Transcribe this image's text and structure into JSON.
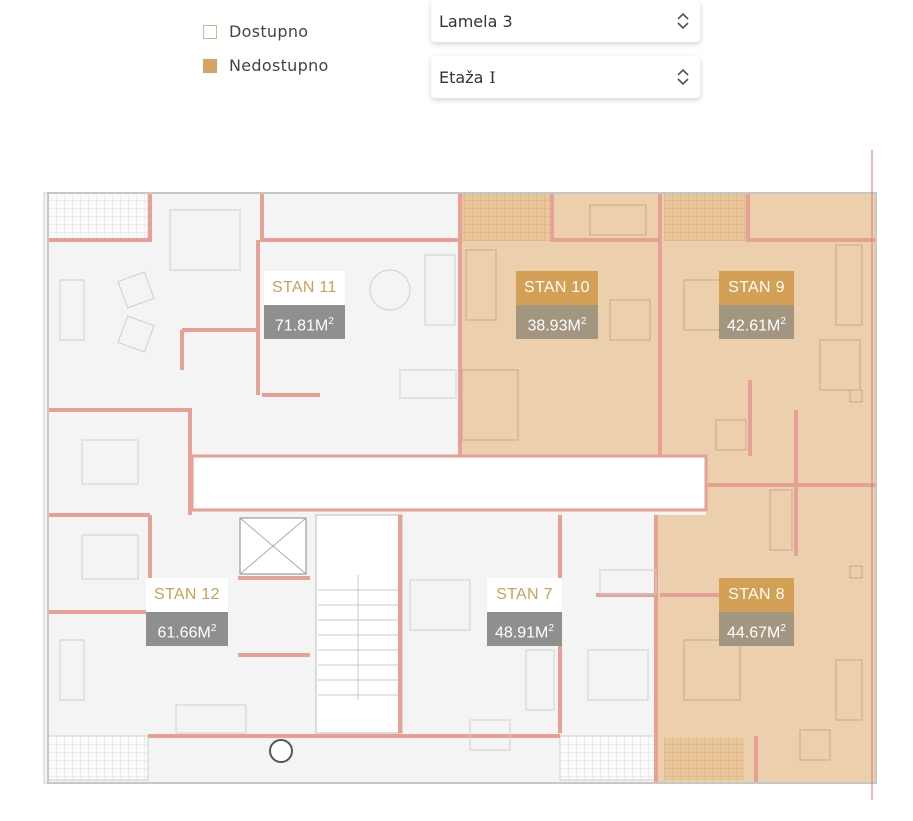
{
  "legend": {
    "available_label": "Dostupno",
    "unavailable_label": "Nedostupno",
    "available_color": "#ffffff",
    "unavailable_color": "#d3a464"
  },
  "filters": {
    "lamela": {
      "value": "Lamela 3",
      "icon": "chevron-updown-icon"
    },
    "etaza": {
      "value": "Etaža",
      "icon": "chevron-updown-icon"
    }
  },
  "colors": {
    "taken_fill": "#e9c9a0",
    "wall": "#e6a095",
    "label_gold": "#c9a15a"
  },
  "apartments": [
    {
      "id": "stan-11",
      "name": "STAN 11",
      "area": "71.81M",
      "unit": "2",
      "status": "available"
    },
    {
      "id": "stan-10",
      "name": "STAN 10",
      "area": "38.93M",
      "unit": "2",
      "status": "unavailable"
    },
    {
      "id": "stan-9",
      "name": "STAN 9",
      "area": "42.61M",
      "unit": "2",
      "status": "unavailable"
    },
    {
      "id": "stan-12",
      "name": "STAN 12",
      "area": "61.66M",
      "unit": "2",
      "status": "available"
    },
    {
      "id": "stan-7",
      "name": "STAN 7",
      "area": "48.91M",
      "unit": "2",
      "status": "available"
    },
    {
      "id": "stan-8",
      "name": "STAN 8",
      "area": "44.67M",
      "unit": "2",
      "status": "unavailable"
    }
  ]
}
